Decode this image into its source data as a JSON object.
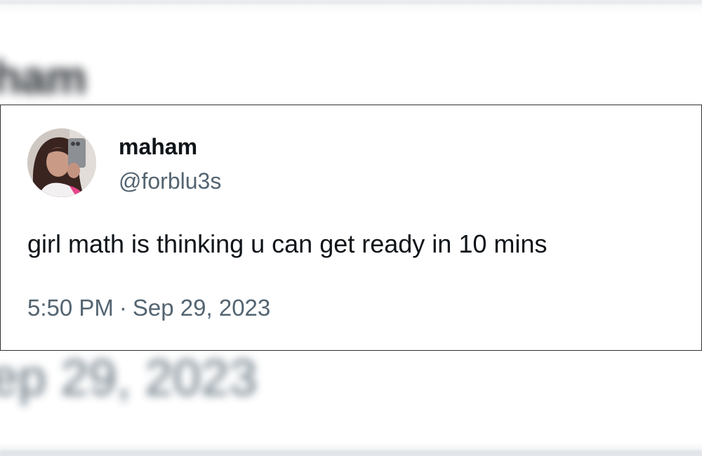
{
  "background": {
    "name_fragment": "ham",
    "date_fragment": "ep 29, 2023"
  },
  "tweet": {
    "author": {
      "display_name": "maham",
      "handle": "@forblu3s",
      "avatar_icon": "profile-photo"
    },
    "text": "girl math is thinking u can get ready in 10 mins",
    "time": "5:50 PM",
    "separator": "·",
    "date": "Sep 29, 2023"
  },
  "colors": {
    "primary_text": "#0f1419",
    "secondary_text": "#536471",
    "border": "#2f3336"
  }
}
